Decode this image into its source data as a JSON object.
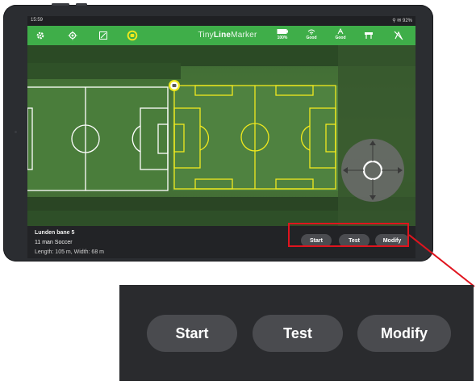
{
  "status_bar": {
    "time": "15:59",
    "right_text": "⚲ ✉ 92%"
  },
  "toolbar": {
    "brand_pre": "Tiny",
    "brand_bold": "Line",
    "brand_post": "Marker",
    "battery_label": "100%",
    "signal_label": "Good",
    "gps_label": "Good"
  },
  "field_info": {
    "name": "Lunden bane 5",
    "type": "11 man Soccer",
    "dimensions": "Length: 105 m, Width: 68 m"
  },
  "actions": {
    "start": "Start",
    "test": "Test",
    "modify": "Modify"
  },
  "zoom_actions": {
    "start": "Start",
    "test": "Test",
    "modify": "Modify"
  },
  "colors": {
    "toolbar_green": "#3fae49",
    "field_outline_white": "#ffffff",
    "field_outline_selected": "#f0e91e",
    "highlight_red": "#e0141e",
    "button_gray": "#4b4c50"
  },
  "icons": [
    "gear-icon",
    "locate-icon",
    "fit-icon",
    "robot-icon",
    "battery-icon",
    "signal-icon",
    "gps-icon",
    "tools-icon",
    "no-gps-icon",
    "joystick-icon"
  ]
}
